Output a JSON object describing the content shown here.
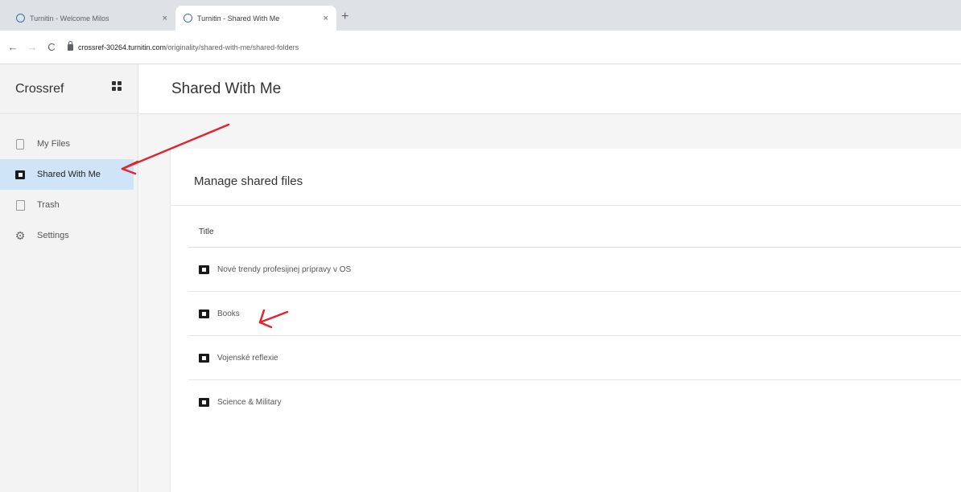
{
  "browser": {
    "tabs": [
      {
        "title": "Turnitin - Welcome Milos",
        "active": false
      },
      {
        "title": "Turnitin - Shared With Me",
        "active": true
      }
    ],
    "url_host": "crossref-30264.turnitin.com",
    "url_path": "/originality/shared-with-me/shared-folders",
    "close_glyph": "×",
    "new_tab_glyph": "+",
    "back_glyph": "←",
    "forward_glyph": "→",
    "reload_glyph": "C"
  },
  "sidebar": {
    "brand": "Crossref",
    "items": [
      {
        "label": "My Files",
        "icon": "file-icon"
      },
      {
        "label": "Shared With Me",
        "icon": "shared-folder-icon",
        "active": true
      },
      {
        "label": "Trash",
        "icon": "trash-icon"
      },
      {
        "label": "Settings",
        "icon": "gear-icon"
      }
    ],
    "gear_glyph": "⚙"
  },
  "header": {
    "title": "Shared With Me"
  },
  "main": {
    "card_title": "Manage shared files",
    "table": {
      "column_title": "Title",
      "rows": [
        {
          "title": "Nové trendy profesijnej prípravy v OS"
        },
        {
          "title": "Books"
        },
        {
          "title": "Vojenské reflexie"
        },
        {
          "title": "Science & Military"
        }
      ]
    }
  },
  "colors": {
    "active_nav": "#cfe4f6",
    "annotation": "#e0262d"
  }
}
